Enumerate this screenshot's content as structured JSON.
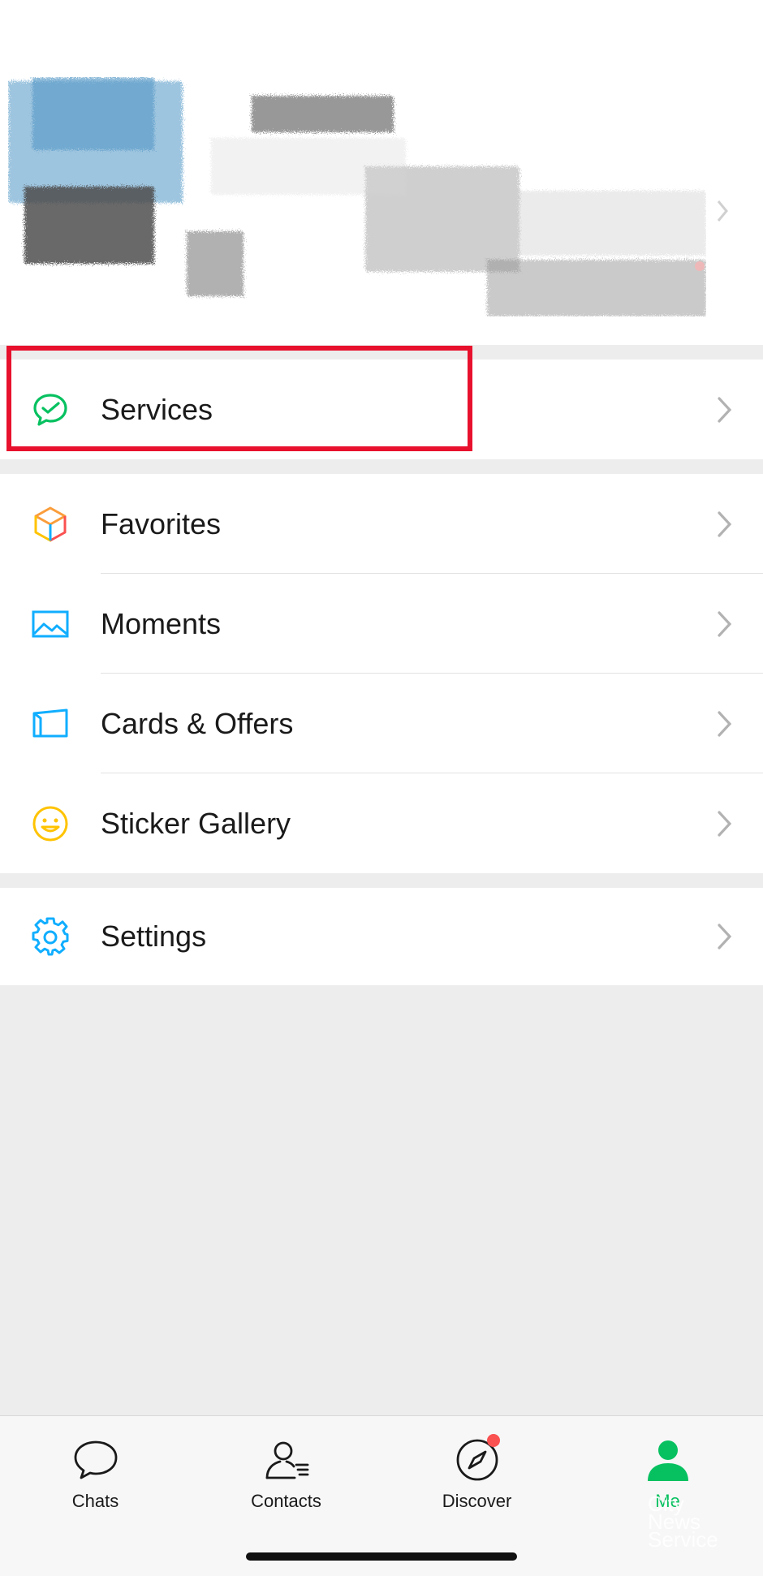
{
  "menu_primary": {
    "items": [
      {
        "label": "Services",
        "icon": "services-icon"
      }
    ]
  },
  "menu_secondary": {
    "items": [
      {
        "label": "Favorites",
        "icon": "favorites-icon"
      },
      {
        "label": "Moments",
        "icon": "moments-icon"
      },
      {
        "label": "Cards & Offers",
        "icon": "cards-icon"
      },
      {
        "label": "Sticker Gallery",
        "icon": "sticker-icon"
      }
    ]
  },
  "menu_settings": {
    "items": [
      {
        "label": "Settings",
        "icon": "gear-icon"
      }
    ]
  },
  "tabbar": {
    "tabs": [
      {
        "label": "Chats",
        "icon": "chat-bubble-icon",
        "active": false
      },
      {
        "label": "Contacts",
        "icon": "contacts-icon",
        "active": false
      },
      {
        "label": "Discover",
        "icon": "compass-icon",
        "active": false,
        "badge": true
      },
      {
        "label": "Me",
        "icon": "person-icon",
        "active": true
      }
    ]
  },
  "watermark": {
    "lines": [
      "City",
      "News",
      "Service"
    ]
  },
  "colors": {
    "accent": "#07c160",
    "highlight": "#e8112d",
    "badge": "#fa5151",
    "background": "#ededed"
  }
}
